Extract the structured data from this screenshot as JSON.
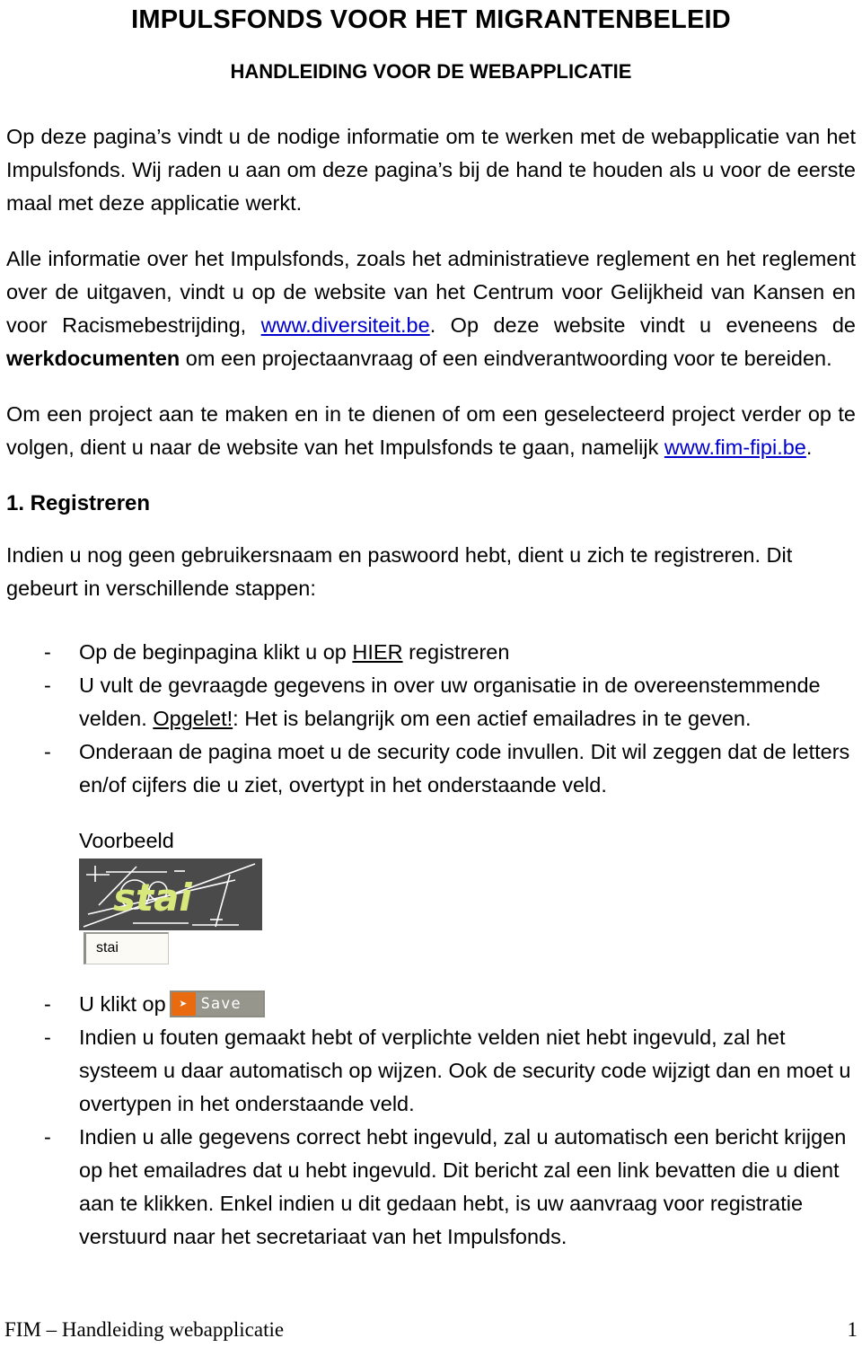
{
  "document": {
    "title": "IMPULSFONDS VOOR HET MIGRANTENBELEID",
    "subtitle": "HANDLEIDING VOOR DE WEBAPPLICATIE"
  },
  "intro": {
    "paragraph": "Op deze pagina’s vindt u de nodige informatie om te werken met de webapplicatie van het Impulsfonds. Wij raden u aan om deze pagina’s bij de hand te houden als u voor de eerste maal met deze applicatie werkt."
  },
  "info_paragraph": {
    "part1": "Alle informatie over het Impulsfonds, zoals het administratieve reglement en het reglement over de uitgaven, vindt u op de website van het Centrum voor Gelijkheid van Kansen en voor Racismebestrijding, ",
    "link": "www.diversiteit.be",
    "part2": ". Op deze website vindt u eveneens de ",
    "bold_term": "werkdocumenten",
    "part3": " om een projectaanvraag of een eindverantwoording voor te bereiden."
  },
  "project_paragraph": {
    "part1": "Om een project aan te maken en in te dienen of om een geselecteerd project verder op te volgen, dient u naar de website van het Impulsfonds te gaan, namelijk ",
    "link": "www.fim-fipi.be",
    "part2": "."
  },
  "section": {
    "heading": "1. Registreren",
    "intro": "Indien u nog geen gebruikersnaam en paswoord hebt, dient u zich te registreren. Dit gebeurt in verschillende stappen:"
  },
  "steps_first": [
    {
      "dash": "-",
      "part1": "Op de beginpagina klikt u op ",
      "underline": "HIER",
      "part2": " registreren"
    },
    {
      "dash": "-",
      "part1": "U vult de gevraagde gegevens in over uw organisatie in de overeenstemmende velden. ",
      "underline": "Opgelet!",
      "part2": ": Het is belangrijk om een actief emailadres in te geven."
    },
    {
      "dash": "-",
      "part1": "Onderaan de pagina moet u de security code invullen. Dit wil zeggen dat de letters en/of cijfers die u ziet, overtypt in het onderstaande veld.",
      "underline": "",
      "part2": ""
    }
  ],
  "example": {
    "label": "Voorbeeld",
    "captcha_text": "stai",
    "captcha_bg_color": "#4a4a4a",
    "captcha_text_color": "#d8e87a",
    "captcha_line_color": "#ffffff",
    "input_value": "stai"
  },
  "steps_second": [
    {
      "dash": "-",
      "text_before_button": "U klikt op",
      "has_button": true,
      "text_after_button": ""
    },
    {
      "dash": "-",
      "text": "Indien u fouten gemaakt hebt of verplichte velden niet hebt ingevuld, zal het systeem u daar automatisch op wijzen. Ook de security code wijzigt dan en moet u overtypen in het onderstaande veld."
    },
    {
      "dash": "-",
      "text": "Indien u alle gegevens correct hebt ingevuld, zal u automatisch een bericht krijgen op het emailadres dat u hebt ingevuld. Dit bericht zal een link bevatten die u dient aan te klikken. Enkel indien u dit gedaan hebt, is uw aanvraag voor registratie verstuurd naar het secretariaat van het Impulsfonds."
    }
  ],
  "save_button": {
    "arrow": "➤",
    "label": "Save",
    "orange_color": "#ea6a10",
    "body_color": "#96968c"
  },
  "footer": {
    "left": "FIM – Handleiding webapplicatie",
    "page_number": "1"
  }
}
